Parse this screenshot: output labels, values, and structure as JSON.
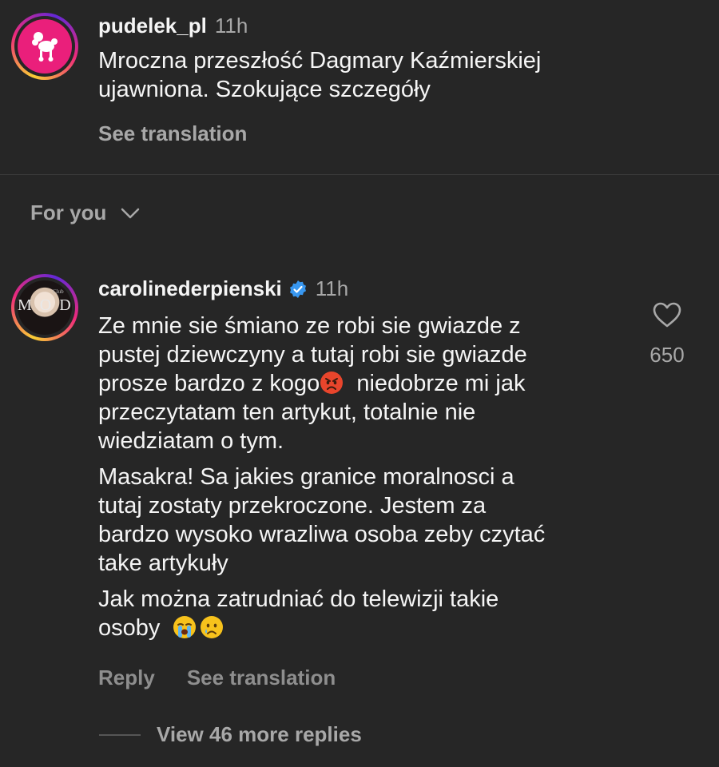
{
  "post": {
    "username": "pudelek_pl",
    "timestamp": "11h",
    "caption_line1": "Mroczna przeszłość Dagmary Kaźmierskiej",
    "caption_line2": "ujawniona. Szokujące szczegóły",
    "see_translation": "See translation",
    "avatar_icon": "poodle-icon"
  },
  "filter": {
    "label": "For you",
    "icon": "chevron-down-icon"
  },
  "comment": {
    "username": "carolinederpienski",
    "verified_icon": "verified-badge-icon",
    "timestamp": "11h",
    "avatar_logo": "MODA",
    "avatar_logo_small": "Club",
    "p1_l1": "Ze mnie sie śmiano ze robi sie gwiazde z",
    "p1_l2": "pustej dziewczyny a tutaj robi sie gwiazde",
    "p1_l3_before": "prosze bardzo z kogo",
    "p1_l3_after": "niedobrze mi jak",
    "p1_l4": "przeczytatam ten artykut, totalnie nie",
    "p1_l5": "wiedziatam o tym.",
    "p2_l1": "Masakra! Sa jakies granice moralnosci a",
    "p2_l2": "tutaj zostaty przekroczone. Jestem za",
    "p2_l3": "bardzo wysoko wrazliwa osoba zeby czytać",
    "p2_l4": "take artykuły",
    "p3_l1": "Jak można zatrudniać do telewizji takie",
    "p3_l2": "osoby",
    "emojis": [
      "angry-face-emoji",
      "loudly-crying-face-emoji",
      "crying-face-emoji"
    ],
    "like_icon": "heart-icon",
    "like_count": "650",
    "reply_label": "Reply",
    "see_translation": "See translation",
    "view_replies": "View 46 more replies"
  },
  "colors": {
    "background": "#262626",
    "text_primary": "#f5f5f5",
    "text_secondary": "#a8a8a8",
    "verified": "#3897f0",
    "pudelek_pink": "#ea1f7b"
  }
}
